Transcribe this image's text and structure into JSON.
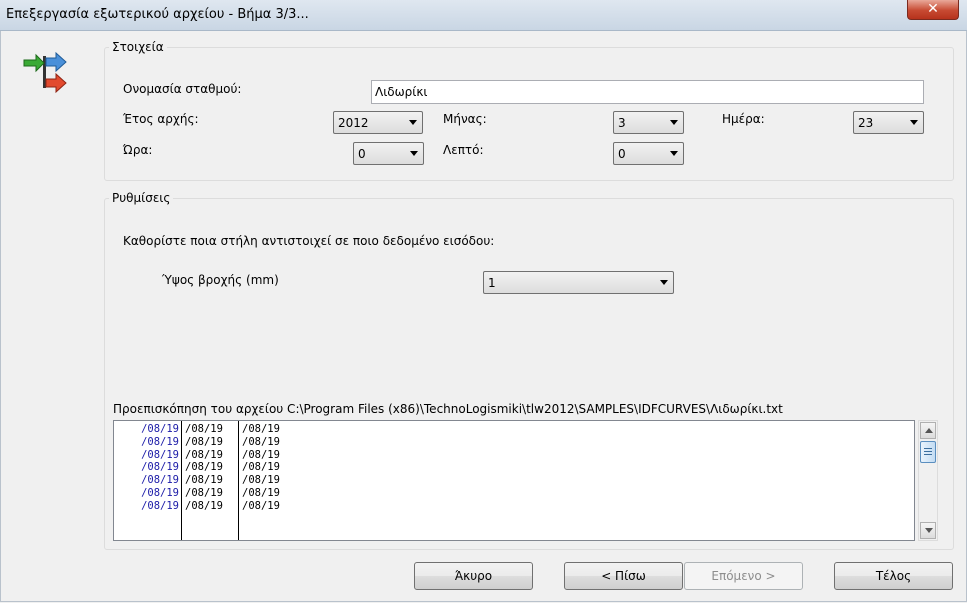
{
  "window": {
    "title": "Επεξεργασία εξωτερικού αρχείου - Βήμα 3/3..."
  },
  "details": {
    "group_label": "Στοιχεία",
    "station_label": "Ονομασία σταθμού:",
    "station_value": "Λιδωρίκι",
    "year_label": "Έτος αρχής:",
    "year_value": "2012",
    "month_label": "Μήνας:",
    "month_value": "3",
    "day_label": "Ημέρα:",
    "day_value": "23",
    "hour_label": "Ώρα:",
    "hour_value": "0",
    "minute_label": "Λεπτό:",
    "minute_value": "0"
  },
  "settings": {
    "group_label": "Ρυθμίσεις",
    "instruction": "Καθορίστε ποια στήλη αντιστοιχεί σε ποιο δεδομένο εισόδου:",
    "rainfall_label": "Ύψος βροχής (mm)",
    "rainfall_column": "1",
    "preview_label": "Προεπισκόπηση του αρχείου C:\\Program Files (x86)\\TechnoLogismiki\\tlw2012\\SAMPLES\\IDFCURVES\\Λιδωρίκι.txt",
    "preview_rows": [
      [
        "/08/19",
        "/08/19",
        "/08/19"
      ],
      [
        "/08/19",
        "/08/19",
        "/08/19"
      ],
      [
        "/08/19",
        "/08/19",
        "/08/19"
      ],
      [
        "/08/19",
        "/08/19",
        "/08/19"
      ],
      [
        "/08/19",
        "/08/19",
        "/08/19"
      ],
      [
        "/08/19",
        "/08/19",
        "/08/19"
      ],
      [
        "/08/19",
        "/08/19",
        "/08/19"
      ]
    ]
  },
  "buttons": {
    "cancel": "Άκυρο",
    "back": "< Πίσω",
    "next": "Επόμενο >",
    "finish": "Τέλος"
  }
}
